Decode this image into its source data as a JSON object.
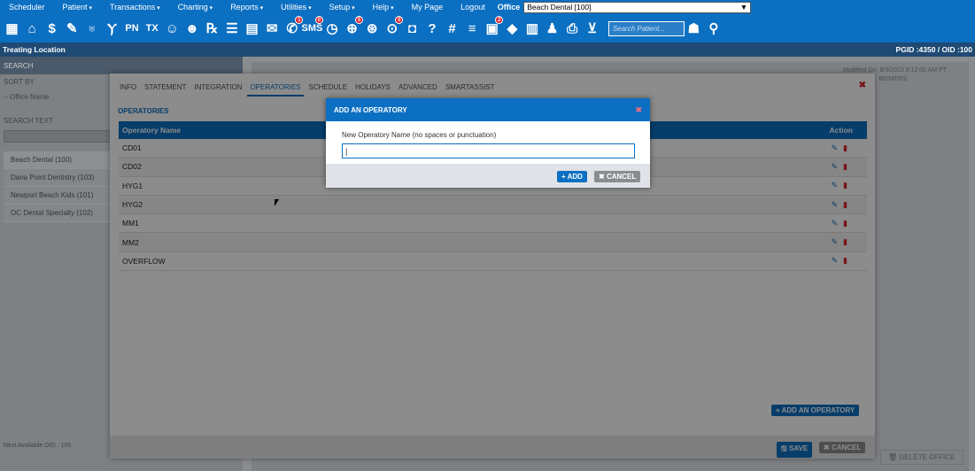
{
  "menu": {
    "items": [
      "Scheduler",
      "Patient",
      "Transactions",
      "Charting",
      "Reports",
      "Utilities",
      "Setup",
      "Help",
      "My Page",
      "Logout"
    ],
    "office_label": "Office",
    "office_value": "Beach Dental [100]"
  },
  "toolbar": {
    "icons": [
      "calendar-icon",
      "home-icon",
      "dollar-icon",
      "pencil-tooth-icon",
      "tooth-icon",
      "tooth-root-icon",
      "pn-icon",
      "tx-icon",
      "patient-add-icon",
      "patients-add-icon",
      "rx-icon",
      "notes-icon",
      "print-icon",
      "envelope-icon",
      "chat-icon",
      "sms-icon",
      "clock-icon",
      "globe-icon",
      "globe-person-icon",
      "person-icon",
      "tooth-small-icon",
      "tooth-question-icon",
      "tooth-number-icon",
      "list-icon",
      "doc-icon",
      "car-icon",
      "newsletter-icon",
      "group-icon",
      "printer-icon",
      "inbox-icon"
    ],
    "badges": {
      "chat": "1",
      "sms": "0",
      "globe": "5",
      "person": "0",
      "doc": "2"
    },
    "search_placeholder": "Search Patient..."
  },
  "locbar": {
    "title": "Treating Location",
    "ids": "PGID :4350  /  OID :100"
  },
  "leftpanel": {
    "search_label": "SEARCH",
    "sort_by": "SORT BY",
    "sort_option": "Office Name",
    "search_text": "SEARCH TEXT",
    "offices": [
      "Beach Dental (100)",
      "Dana Point Dentistry (103)",
      "Newport Beach Kids (101)",
      "OC Dental Specialty (102)"
    ],
    "next_oid": "Next Available OID : 105"
  },
  "background": {
    "modified": "Modified On: 8/3/2023 9:12:00 AM PT",
    "modified_by": "BEIMERS",
    "delete_office": "DELETE OFFICE"
  },
  "modal": {
    "tabs": [
      "INFO",
      "STATEMENT",
      "INTEGRATION",
      "OPERATORIES",
      "SCHEDULE",
      "HOLIDAYS",
      "ADVANCED",
      "SMARTASSIST"
    ],
    "active_tab": "OPERATORIES",
    "section_title": "OPERATORIES",
    "col_name": "Operatory Name",
    "col_action": "Action",
    "rows": [
      "CD01",
      "CD02",
      "HYG1",
      "HYG2",
      "MM1",
      "MM2",
      "OVERFLOW"
    ],
    "add_button": "+ ADD AN OPERATORY",
    "save": "SAVE",
    "cancel": "CANCEL"
  },
  "dialog": {
    "title": "ADD AN OPERATORY",
    "label": "New Operatory Name (no spaces or punctuation)",
    "value": "",
    "add": "+ ADD",
    "cancel": "CANCEL"
  },
  "colors": {
    "brand": "#0b6fc2",
    "danger": "#d9252b"
  }
}
